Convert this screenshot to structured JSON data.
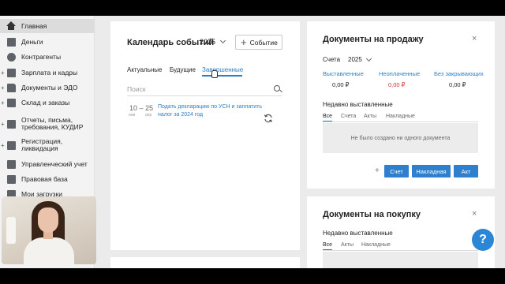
{
  "sidebar": {
    "items": [
      {
        "label": "Главная",
        "icon": "home-icon",
        "active": true
      },
      {
        "label": "Деньги",
        "icon": "money-icon"
      },
      {
        "label": "Контрагенты",
        "icon": "contacts-icon"
      },
      {
        "label": "Зарплата и кадры",
        "icon": "salary-icon",
        "expandable": true
      },
      {
        "label": "Документы и ЭДО",
        "icon": "documents-icon",
        "expandable": true
      },
      {
        "label": "Склад и заказы",
        "icon": "warehouse-icon",
        "expandable": true
      },
      {
        "label": "Отчеты, письма, требования, КУДИР",
        "icon": "reports-icon",
        "expandable": true
      },
      {
        "label": "Регистрация, ликвидация",
        "icon": "registration-icon",
        "expandable": true
      },
      {
        "label": "Управленческий учет",
        "icon": "management-icon"
      },
      {
        "label": "Правовая база",
        "icon": "law-icon"
      },
      {
        "label": "Мои загрузки",
        "icon": "downloads-icon"
      }
    ]
  },
  "calendar": {
    "title": "Календарь событий",
    "year": "2025",
    "add_label": "Событие",
    "tabs": [
      "Актуальные",
      "Будущие",
      "Завершенные"
    ],
    "search_placeholder": "Поиск",
    "event": {
      "range": "10 – 25",
      "month_from": "янв",
      "month_to": "апр",
      "text": "Подать декларацию по УСН и заплатить налог за 2024 год"
    }
  },
  "sales_docs": {
    "title": "Документы на продажу",
    "invoices_label": "Счета",
    "year": "2025",
    "stats": [
      {
        "label": "Выставленные",
        "value": "0,00 ₽",
        "color": "#222222"
      },
      {
        "label": "Неоплаченные",
        "value": "0,00 ₽",
        "color": "#d0342c"
      },
      {
        "label": "Без закрывающих",
        "value": "0,00 ₽",
        "color": "#222222"
      }
    ],
    "recent_label": "Недавно выставленные",
    "tabs": [
      "Все",
      "Счета",
      "Акты",
      "Накладные"
    ],
    "empty_text": "Не было создано ни одного документа",
    "buttons": [
      "Счет",
      "Накладная",
      "Акт"
    ]
  },
  "purchase_docs": {
    "title": "Документы на покупку",
    "recent_label": "Недавно выставленные",
    "tabs": [
      "Все",
      "Акты",
      "Накладные"
    ]
  },
  "help": {
    "label": "?"
  },
  "colors": {
    "accent": "#2a7ec4",
    "button": "#2e7fce",
    "negative": "#d0342c"
  }
}
